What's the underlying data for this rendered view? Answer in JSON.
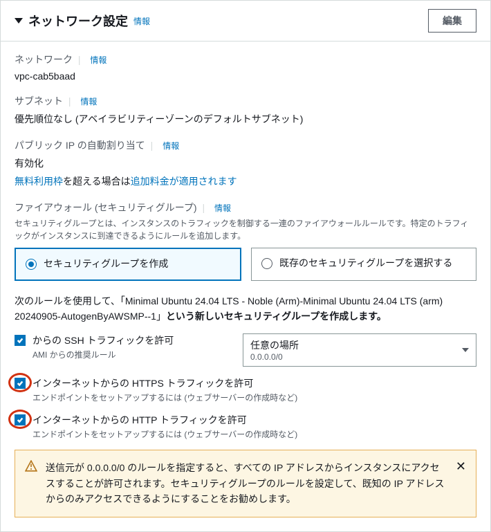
{
  "panel": {
    "title": "ネットワーク設定",
    "info": "情報",
    "edit": "編集"
  },
  "network": {
    "label": "ネットワーク",
    "info": "情報",
    "value": "vpc-cab5baad"
  },
  "subnet": {
    "label": "サブネット",
    "info": "情報",
    "value": "優先順位なし (アベイラビリティーゾーンのデフォルトサブネット)"
  },
  "publicIp": {
    "label": "パブリック IP の自動割り当て",
    "info": "情報",
    "value": "有効化",
    "freeTier1": "無料利用枠",
    "freeTier2": "を超える場合は",
    "freeTier3": "追加料金が適用されます"
  },
  "firewall": {
    "label": "ファイアウォール (セキュリティグループ)",
    "info": "情報",
    "desc": "セキュリティグループとは、インスタンスのトラフィックを制御する一連のファイアウォールルールです。特定のトラフィックがインスタンスに到達できるようにルールを追加します。",
    "radioCreate": "セキュリティグループを作成",
    "radioExisting": "既存のセキュリティグループを選択する",
    "ruleText1": "次のルールを使用して、「",
    "ruleSgName": "Minimal Ubuntu 24.04 LTS - Noble (Arm)-Minimal Ubuntu 24.04 LTS (arm) 20240905-AutogenByAWSMP--1",
    "ruleText2": "」",
    "ruleText3": "という新しいセキュリティグループを作成します。"
  },
  "ssh": {
    "label": "からの SSH トラフィックを許可",
    "desc": "AMI からの推奨ルール",
    "selectMain": "任意の場所",
    "selectSub": "0.0.0.0/0"
  },
  "https": {
    "label": "インターネットからの HTTPS トラフィックを許可",
    "desc": "エンドポイントをセットアップするには (ウェブサーバーの作成時など)"
  },
  "http": {
    "label": "インターネットからの HTTP トラフィックを許可",
    "desc": "エンドポイントをセットアップするには (ウェブサーバーの作成時など)"
  },
  "warning": {
    "text": "送信元が 0.0.0.0/0 のルールを指定すると、すべての IP アドレスからインスタンスにアクセスすることが許可されます。セキュリティグループのルールを設定して、既知の IP アドレスからのみアクセスできるようにすることをお勧めします。"
  }
}
